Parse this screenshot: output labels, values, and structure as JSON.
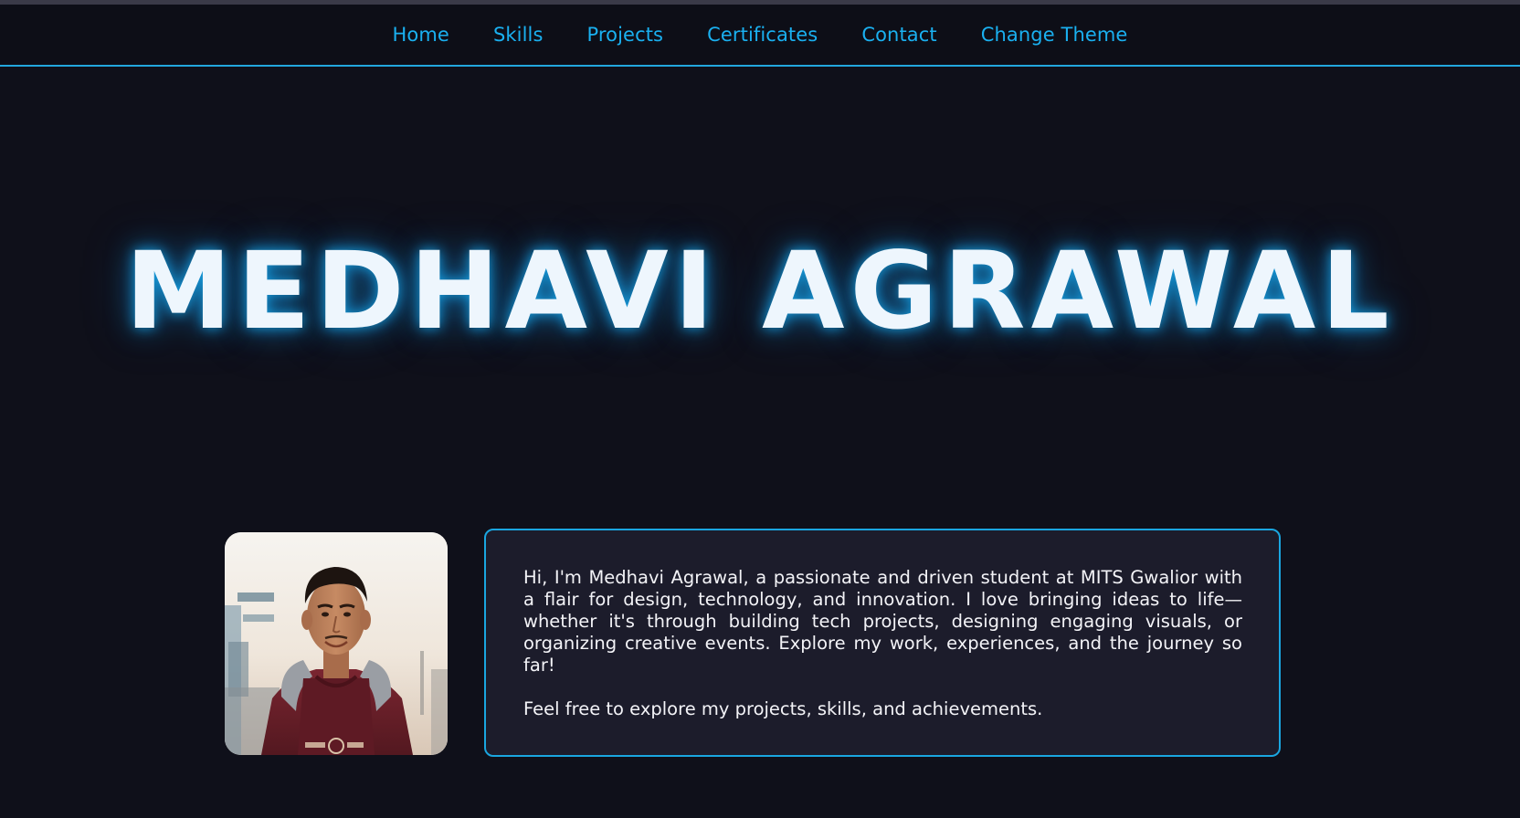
{
  "nav": {
    "items": [
      {
        "label": "Home"
      },
      {
        "label": "Skills"
      },
      {
        "label": "Projects"
      },
      {
        "label": "Certificates"
      },
      {
        "label": "Contact"
      },
      {
        "label": "Change Theme"
      }
    ]
  },
  "hero": {
    "title": "MEDHAVI AGRAWAL"
  },
  "about": {
    "paragraph1": "Hi, I'm Medhavi Agrawal, a passionate and driven student at MITS Gwalior with a flair for design, technology, and innovation. I love bringing ideas to life—whether it's through building tech projects, designing engaging visuals, or organizing creative events. Explore my work, experiences, and the journey so far!",
    "paragraph2": "Feel free to explore my projects, skills, and achievements."
  },
  "colors": {
    "background": "#0f101a",
    "accent": "#1ab0f0",
    "card": "#1c1c2b",
    "title_text": "#eef6fd"
  }
}
